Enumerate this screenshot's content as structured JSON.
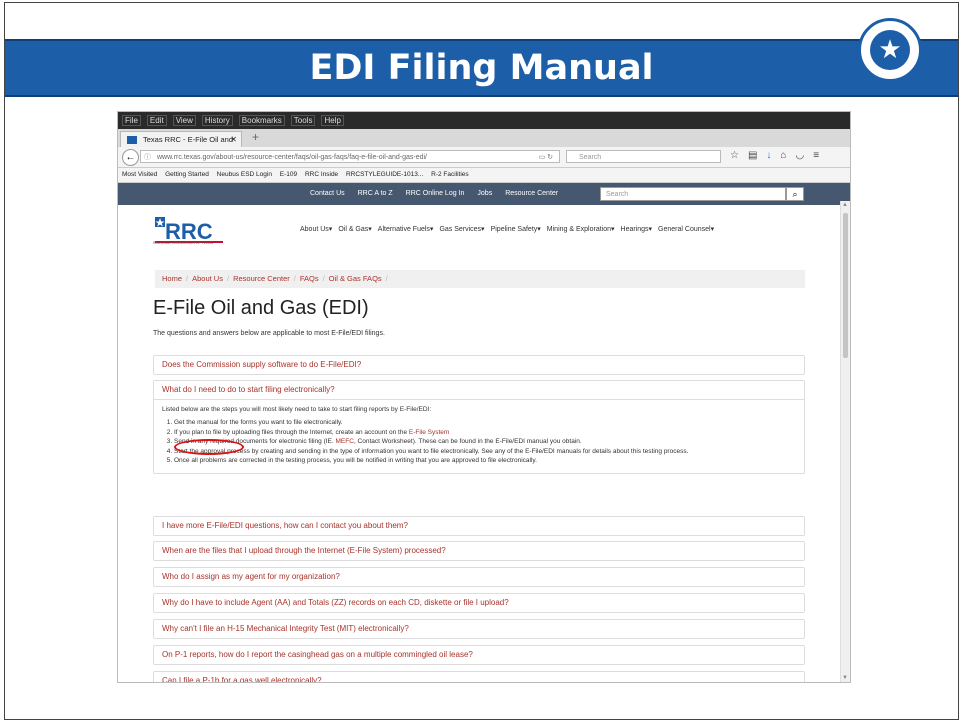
{
  "slide": {
    "title": "EDI Filing Manual",
    "seal_text": "RAILROAD COMMISSION OF TEXAS"
  },
  "browser": {
    "menu": [
      "File",
      "Edit",
      "View",
      "History",
      "Bookmarks",
      "Tools",
      "Help"
    ],
    "tab_title": "Texas RRC - E-File Oil and Ga",
    "url": "www.rrc.texas.gov/about-us/resource-center/faqs/oil-gas-faqs/faq-e-file-oil-and-gas-edi/",
    "search_placeholder": "Search",
    "bookmarks": [
      "Most Visited",
      "Getting Started",
      "Neubus ESD Login",
      "E-109",
      "RRC Inside",
      "RRCSTYLEGUIDE-1013...",
      "R-2 Facilities"
    ]
  },
  "site": {
    "top_links": [
      "Contact Us",
      "RRC A to Z",
      "RRC Online Log In",
      "Jobs",
      "Resource Center"
    ],
    "search_placeholder": "Search",
    "logo_text": "RRC",
    "logo_subtext": "RAILROAD COMMISSION OF TEXAS",
    "main_nav": [
      "About Us▾",
      "Oil & Gas▾",
      "Alternative Fuels▾",
      "Gas Services▾",
      "Pipeline Safety▾",
      "Mining & Exploration▾",
      "Hearings▾",
      "General Counsel▾"
    ],
    "breadcrumb": [
      "Home",
      "About Us",
      "Resource Center",
      "FAQs",
      "Oil & Gas FAQs"
    ],
    "heading": "E-File Oil and Gas (EDI)",
    "intro": "The questions and answers below are applicable to most E-File/EDI filings."
  },
  "faqs": {
    "q1": "Does the Commission supply software to do E-File/EDI?",
    "q2": "What do I need to do to start filing electronically?",
    "q2_answer_intro": "Listed below are the steps you will most likely need to take to start filing reports by E-File/EDI:",
    "q2_step1": "Get the manual for the forms you want to file electronically.",
    "q2_step2_pre": "If you plan to file by uploading files through the Internet, create an account on the ",
    "q2_step2_link": "E-File System",
    "q2_step3_pre": "Send in any required documents for electronic filing (IE. ",
    "q2_step3_link": "MEFC",
    "q2_step3_post": ", Contact Worksheet). These can be found in the E-File/EDI manual you obtain.",
    "q2_step4": "Start the approval process by creating and sending in the type of information you want to file electronically. See any of the E-File/EDI manuals for details about this testing process.",
    "q2_step5": "Once all problems are corrected in the testing process, you will be notified in writing that you are approved to file electronically.",
    "q3": "I have more E-File/EDI questions, how can I contact you about them?",
    "q4": "When are the files that I upload through the Internet (E-File System) processed?",
    "q5": "Who do I assign as my agent for my organization?",
    "q6": "Why do I have to include Agent (AA) and Totals (ZZ) records on each CD, diskette or file I upload?",
    "q7": "Why can't I file an H-15 Mechanical Integrity Test (MIT) electronically?",
    "q8": "On P-1 reports, how do I report the casinghead gas on a multiple commingled oil lease?",
    "q9": "Can I file a P-1b for a gas well electronically?"
  }
}
